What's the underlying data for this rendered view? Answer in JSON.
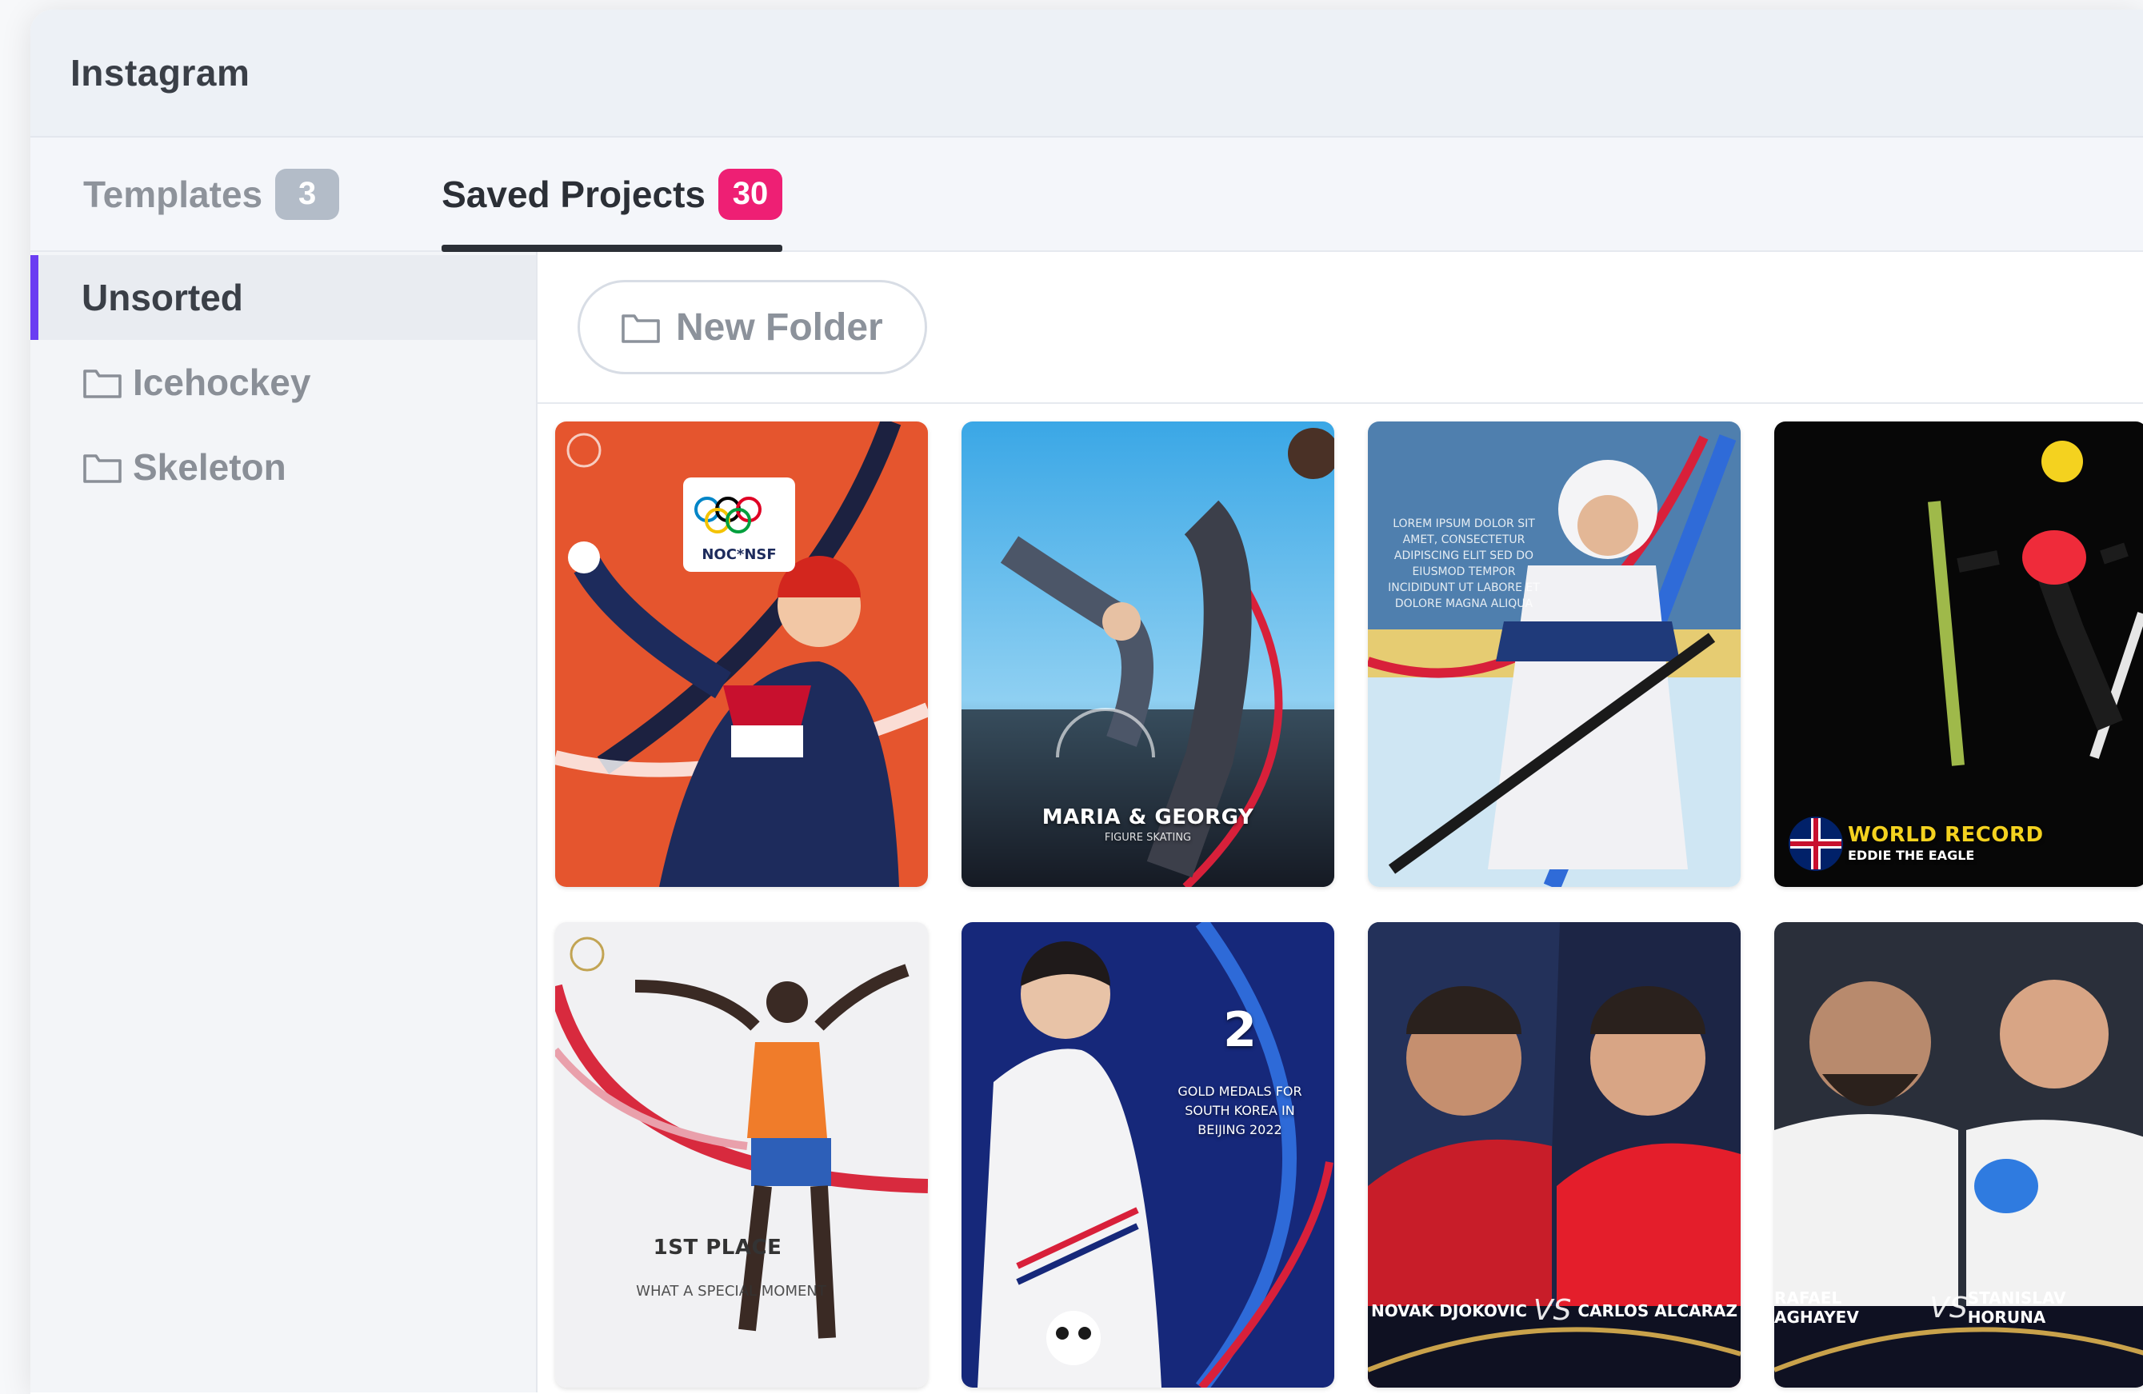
{
  "app": {
    "title": "Instagram"
  },
  "tabs": [
    {
      "label": "Templates",
      "count": "3"
    },
    {
      "label": "Saved Projects",
      "count": "30"
    }
  ],
  "sidebar": {
    "items": [
      {
        "label": "Unsorted"
      },
      {
        "label": "Icehockey"
      },
      {
        "label": "Skeleton"
      }
    ]
  },
  "toolbar": {
    "new_folder_label": "New Folder"
  },
  "colors": {
    "accent": "#6a3df2",
    "badge_pink": "#ee1f74",
    "badge_grey": "#b3bcc8"
  },
  "projects": [
    {
      "theme": "orange speed skater",
      "logo": "NOC*NSF"
    },
    {
      "theme": "figure skating",
      "title": "MARIA & GEORGY",
      "subtitle": "FIGURE SKATING"
    },
    {
      "theme": "ice hockey",
      "lorem": "LOREM IPSUM DOLOR SIT AMET, CONSECTETUR ADIPISCING ELIT SED DO EIUSMOD TEMPOR INCIDIDUNT UT LABORE ET DOLORE MAGNA ALIQUA"
    },
    {
      "theme": "ski jumping",
      "title": "WORLD RECORD",
      "subtitle": "EDDIE THE EAGLE"
    },
    {
      "theme": "marathon",
      "title": "1ST PLACE",
      "subtitle": "WHAT A SPECIAL MOMENT"
    },
    {
      "theme": "short track",
      "number": "2",
      "text": "GOLD MEDALS FOR SOUTH KOREA IN BEIJING 2022"
    },
    {
      "theme": "tennis",
      "left": "NOVAK DJOKOVIC",
      "right": "CARLOS ALCARAZ",
      "vs": "VS"
    },
    {
      "theme": "judo",
      "left": "RAFAEL AGHAYEV",
      "right": "STANISLAV HORUNA",
      "vs": "VS"
    }
  ]
}
